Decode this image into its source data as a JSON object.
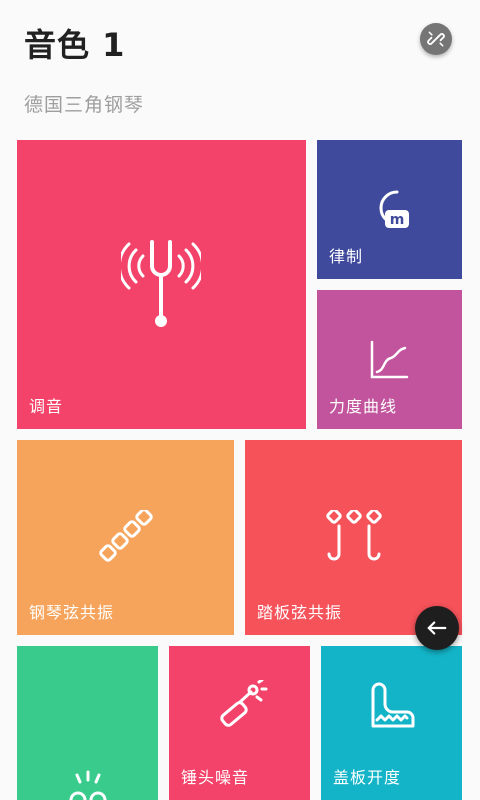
{
  "header": {
    "title": "音色 1",
    "subtitle": "德国三角钢琴"
  },
  "icons": {
    "link": "link-off-icon",
    "back": "arrow-left-icon"
  },
  "tiles": [
    {
      "label": "调音",
      "icon": "tuning-fork-icon",
      "color": "#f4436a"
    },
    {
      "label": "律制",
      "icon": "temperament-icon",
      "color": "#3f4a9c"
    },
    {
      "label": "力度曲线",
      "icon": "velocity-curve-icon",
      "color": "#c1549c"
    },
    {
      "label": "钢琴弦共振",
      "icon": "string-resonance-icon",
      "color": "#f6a45b"
    },
    {
      "label": "踏板弦共振",
      "icon": "pedal-resonance-icon",
      "color": "#f5525a"
    },
    {
      "label": "",
      "icon": "hammer-icon",
      "color": "#38cb8c"
    },
    {
      "label": "锤头噪音",
      "icon": "hammer-noise-icon",
      "color": "#f4436a"
    },
    {
      "label": "盖板开度",
      "icon": "piano-lid-icon",
      "color": "#13b4c8"
    }
  ]
}
